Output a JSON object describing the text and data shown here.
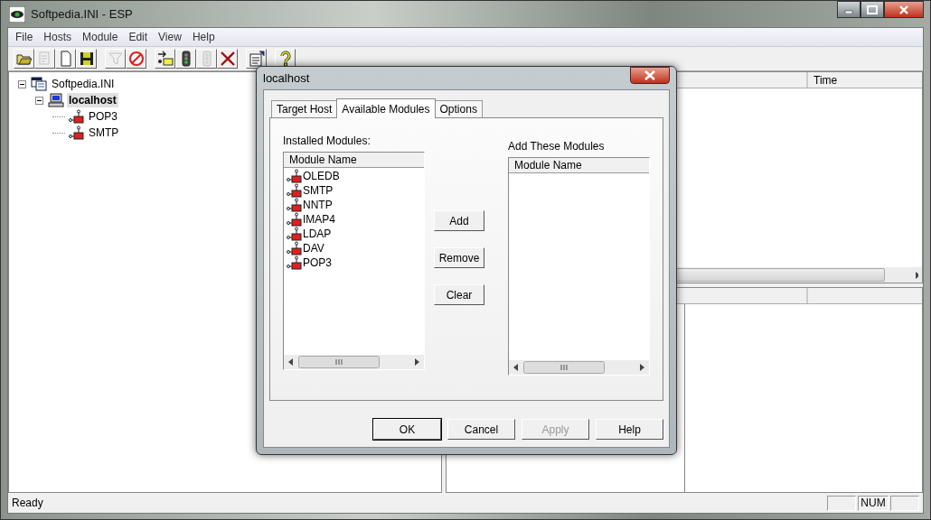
{
  "window": {
    "title": "Softpedia.INI - ESP"
  },
  "menu": [
    "File",
    "Hosts",
    "Module",
    "Edit",
    "View",
    "Help"
  ],
  "toolbar": [
    {
      "kind": "open",
      "disabled": false
    },
    {
      "kind": "import",
      "disabled": true
    },
    {
      "kind": "new",
      "disabled": false
    },
    {
      "kind": "save",
      "disabled": false
    },
    {
      "kind": "sep"
    },
    {
      "kind": "filter",
      "disabled": true
    },
    {
      "kind": "stop",
      "disabled": false
    },
    {
      "kind": "sep"
    },
    {
      "kind": "connect",
      "disabled": false
    },
    {
      "kind": "light",
      "disabled": false
    },
    {
      "kind": "light",
      "disabled": true
    },
    {
      "kind": "delete",
      "disabled": false
    },
    {
      "kind": "sep"
    },
    {
      "kind": "properties",
      "disabled": false
    },
    {
      "kind": "sep"
    },
    {
      "kind": "help",
      "disabled": false
    }
  ],
  "tree": [
    {
      "label": "Softpedia.INI",
      "kind": "file",
      "selected": false,
      "expanded": true,
      "children": [
        {
          "label": "localhost",
          "kind": "host",
          "selected": true,
          "expanded": true,
          "children": [
            {
              "label": "POP3",
              "kind": "module",
              "selected": false
            },
            {
              "label": "SMTP",
              "kind": "module",
              "selected": false
            }
          ]
        }
      ]
    }
  ],
  "event_list": {
    "columns": [
      "Time"
    ]
  },
  "dialog": {
    "title": "localhost",
    "tabs": [
      {
        "label": "Target Host",
        "selected": false
      },
      {
        "label": "Available Modules",
        "selected": true
      },
      {
        "label": "Options",
        "selected": false
      }
    ],
    "installed": {
      "label": "Installed Modules:",
      "column": "Module Name",
      "items": [
        "OLEDB",
        "SMTP",
        "NNTP",
        "IMAP4",
        "LDAP",
        "DAV",
        "POP3"
      ]
    },
    "actions": [
      "Add",
      "Remove",
      "Clear"
    ],
    "to_add": {
      "label": "Add These Modules",
      "column": "Module Name"
    },
    "buttons": [
      {
        "label": "OK",
        "disabled": false,
        "default": true
      },
      {
        "label": "Cancel",
        "disabled": false,
        "default": false
      },
      {
        "label": "Apply",
        "disabled": true,
        "default": false
      },
      {
        "label": "Help",
        "disabled": false,
        "default": false
      }
    ]
  },
  "status_bar": {
    "text": "Ready",
    "indicators": [
      "NUM"
    ]
  }
}
